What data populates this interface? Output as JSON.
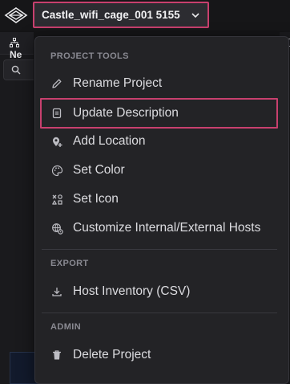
{
  "header": {
    "project_name": "Castle_wifi_cage_001 5155",
    "logo_icon": "diamond-logo-icon",
    "dropdown_icon": "chevron-down-icon"
  },
  "background": {
    "panel_title_partial": "Ne",
    "search_icon": "search-icon"
  },
  "menu": {
    "sections": [
      {
        "label": "PROJECT TOOLS",
        "items": [
          {
            "label": "Rename Project",
            "icon": "pencil-icon"
          },
          {
            "label": "Update Description",
            "icon": "document-icon",
            "highlighted": true
          },
          {
            "label": "Add Location",
            "icon": "map-pin-plus-icon"
          },
          {
            "label": "Set Color",
            "icon": "palette-icon"
          },
          {
            "label": "Set Icon",
            "icon": "shapes-icon"
          },
          {
            "label": "Customize Internal/External Hosts",
            "icon": "globe-settings-icon"
          }
        ]
      },
      {
        "label": "EXPORT",
        "items": [
          {
            "label": "Host Inventory (CSV)",
            "icon": "download-icon"
          }
        ]
      },
      {
        "label": "ADMIN",
        "items": [
          {
            "label": "Delete Project",
            "icon": "trash-icon"
          }
        ]
      }
    ]
  },
  "colors": {
    "highlight_border": "#c8406e",
    "menu_bg": "#232326",
    "page_bg": "#141416"
  }
}
